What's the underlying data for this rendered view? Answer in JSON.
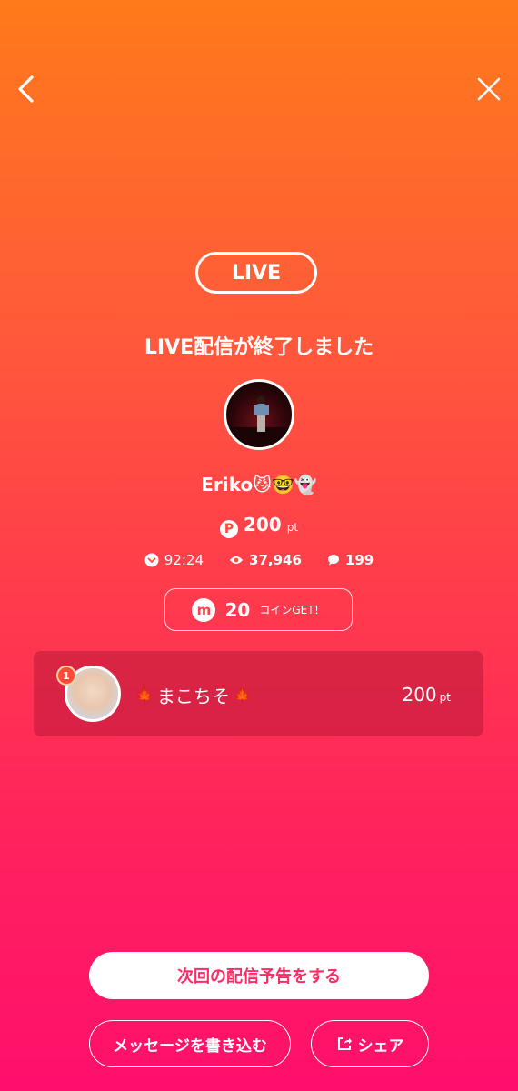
{
  "live_badge": "LIVE",
  "ended_message": "LIVE配信が終了しました",
  "streamer": {
    "name": "Eriko",
    "emojis": "😼🤓👻"
  },
  "points": {
    "value": "200",
    "unit": "pt"
  },
  "stats": {
    "duration": "92:24",
    "views": "37,946",
    "comments": "199"
  },
  "coins": {
    "icon_letter": "m",
    "value": "20",
    "label": "コインGET！"
  },
  "ranking": [
    {
      "rank": "1",
      "name": "まこちそ",
      "leaf": "🍁",
      "points": "200",
      "unit": "pt"
    }
  ],
  "buttons": {
    "schedule": "次回の配信予告をする",
    "message": "メッセージを書き込む",
    "share": "シェア"
  },
  "colors": {
    "gradient_top": "#ff7a1a",
    "gradient_bottom": "#ff0f6c",
    "accent": "#ff2a66"
  }
}
